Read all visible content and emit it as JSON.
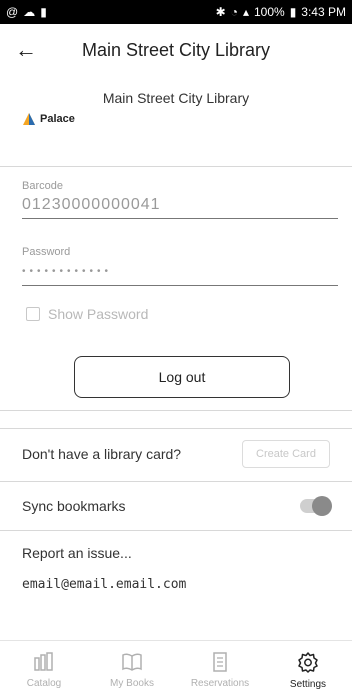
{
  "status_bar": {
    "left_icons": [
      "at-icon",
      "cloud-icon",
      "battery-small-icon"
    ],
    "right_text": "100%",
    "time": "3:43 PM"
  },
  "app_bar": {
    "title": "Main Street City Library"
  },
  "library": {
    "name": "Main Street City Library",
    "logo_text": "Palace"
  },
  "login": {
    "barcode_label": "Barcode",
    "barcode_value": "01230000000041",
    "password_label": "Password",
    "password_mask": "••••••••••••",
    "show_password_label": "Show Password",
    "logout_label": "Log out"
  },
  "card": {
    "prompt": "Don't have a library card?",
    "create_label": "Create Card"
  },
  "sync": {
    "label": "Sync bookmarks",
    "enabled": true
  },
  "report": {
    "label": "Report an issue...",
    "email": "email@email.email.com"
  },
  "bottom_nav": {
    "items": [
      {
        "label": "Catalog",
        "icon": "catalog-icon",
        "active": false
      },
      {
        "label": "My Books",
        "icon": "book-icon",
        "active": false
      },
      {
        "label": "Reservations",
        "icon": "reservations-icon",
        "active": false
      },
      {
        "label": "Settings",
        "icon": "gear-icon",
        "active": true
      }
    ]
  },
  "colors": {
    "status_bar_bg": "#000000",
    "text": "#1a1a1a",
    "muted": "#9a9a9a",
    "divider": "#d8d8d8",
    "logo_orange": "#f5a623",
    "logo_blue": "#2b6cb0"
  }
}
